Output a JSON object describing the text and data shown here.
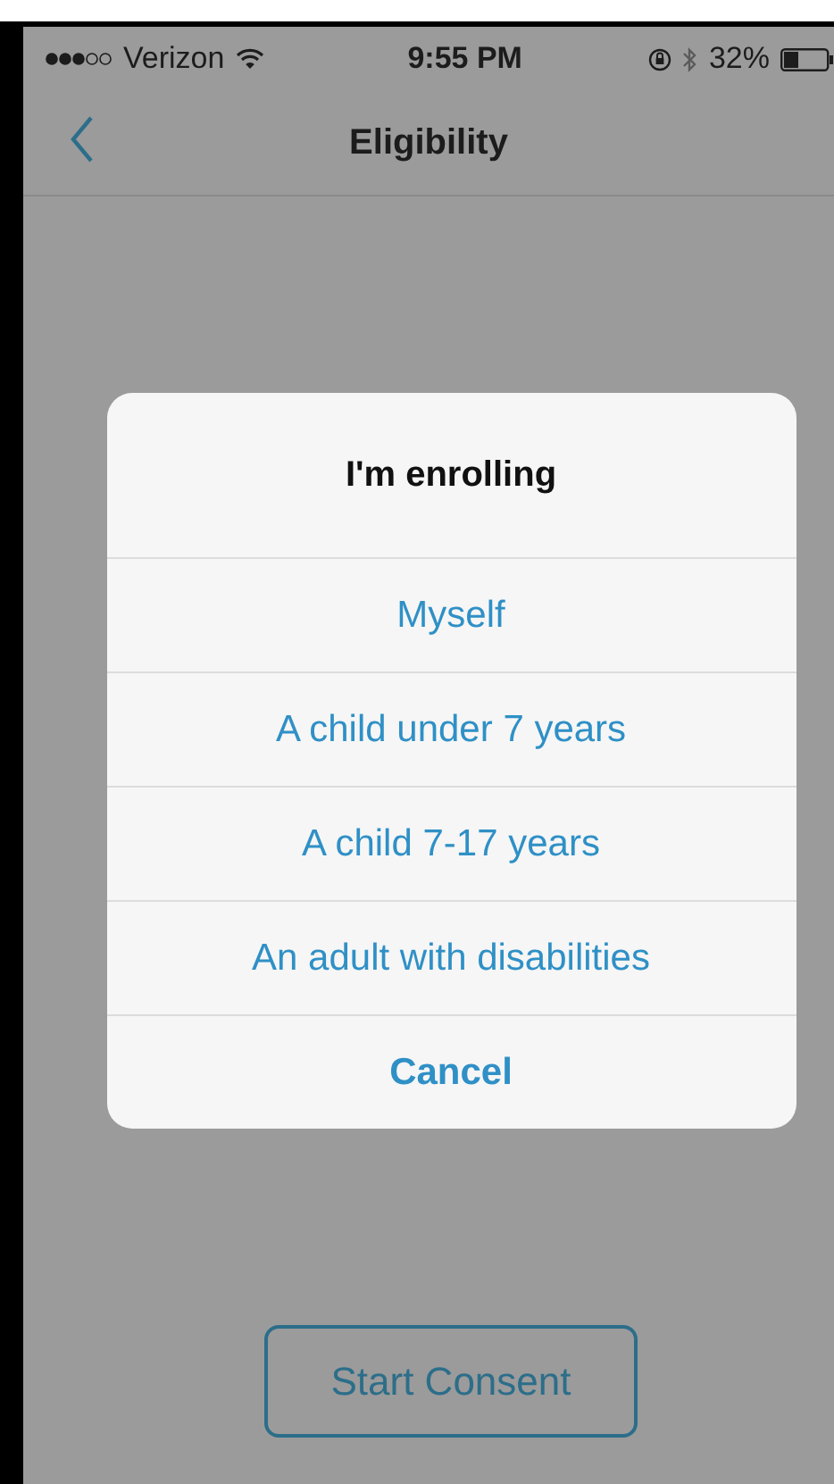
{
  "status_bar": {
    "carrier": "Verizon",
    "time": "9:55 PM",
    "battery": "32%"
  },
  "nav": {
    "title": "Eligibility"
  },
  "dialog": {
    "title": "I'm enrolling",
    "options": [
      {
        "label": "Myself",
        "kind": "option"
      },
      {
        "label": "A child under 7 years",
        "kind": "option"
      },
      {
        "label": "A child 7-17 years",
        "kind": "option"
      },
      {
        "label": "An adult with disabilities",
        "kind": "option"
      },
      {
        "label": "Cancel",
        "kind": "cancel"
      }
    ]
  },
  "start_button": {
    "label": "Start Consent"
  }
}
